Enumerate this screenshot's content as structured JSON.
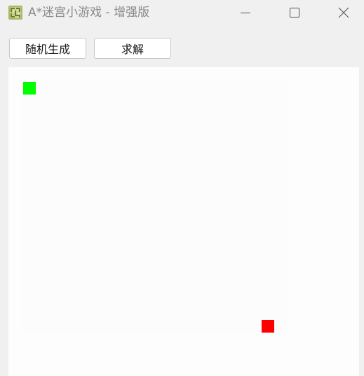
{
  "window": {
    "title": "A*迷宫小游戏 - 增强版",
    "icon": "maze-app-icon",
    "controls": {
      "minimize_icon": "minimize-icon",
      "maximize_icon": "maximize-icon",
      "close_icon": "close-icon"
    }
  },
  "toolbar": {
    "generate_label": "随机生成",
    "solve_label": "求解"
  },
  "maze": {
    "start_color": "#00ff00",
    "goal_color": "#ff0000",
    "background_color": "#fdfdfd"
  }
}
